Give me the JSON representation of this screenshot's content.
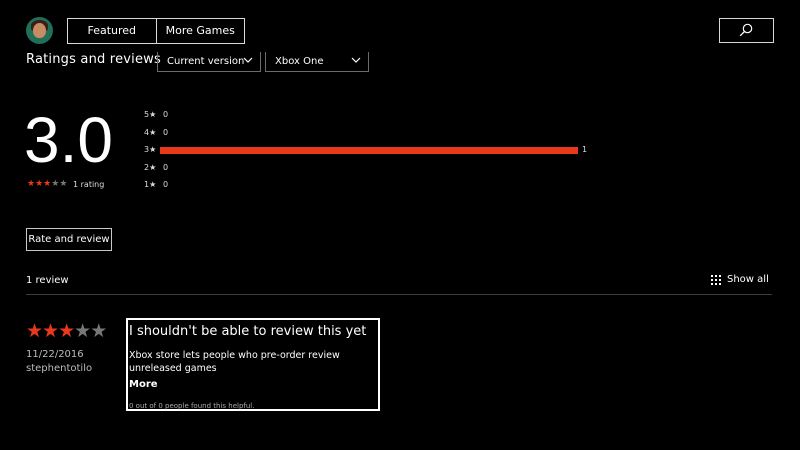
{
  "nav": {
    "tabs": [
      {
        "label": "Featured"
      },
      {
        "label": "More Games"
      }
    ],
    "search_icon": "search-icon",
    "avatar_icon": "avatar"
  },
  "section": {
    "title": "Ratings and reviews",
    "filter_version": "Current version",
    "filter_platform": "Xbox One"
  },
  "summary": {
    "average": "3.0",
    "stars_filled": 3,
    "stars_total": 5,
    "rating_count_text": "1 rating"
  },
  "histogram": [
    {
      "label": "5★",
      "count": "0",
      "fraction": 0
    },
    {
      "label": "4★",
      "count": "0",
      "fraction": 0
    },
    {
      "label": "3★",
      "count": "1",
      "fraction": 1
    },
    {
      "label": "2★",
      "count": "0",
      "fraction": 0
    },
    {
      "label": "1★",
      "count": "0",
      "fraction": 0
    }
  ],
  "actions": {
    "rate_button": "Rate and review",
    "show_all": "Show all"
  },
  "reviews_header": {
    "count_text": "1 review"
  },
  "review": {
    "stars_filled": 3,
    "stars_total": 5,
    "date": "11/22/2016",
    "author": "stephentotilo",
    "title": "I shouldn't be able to review this yet",
    "body": "Xbox store lets people who pre-order review unreleased games",
    "more_label": "More",
    "helpful_text": "0 out of 0 people found this helpful."
  },
  "colors": {
    "accent": "#e8391b",
    "background": "#000000",
    "text": "#ffffff"
  }
}
